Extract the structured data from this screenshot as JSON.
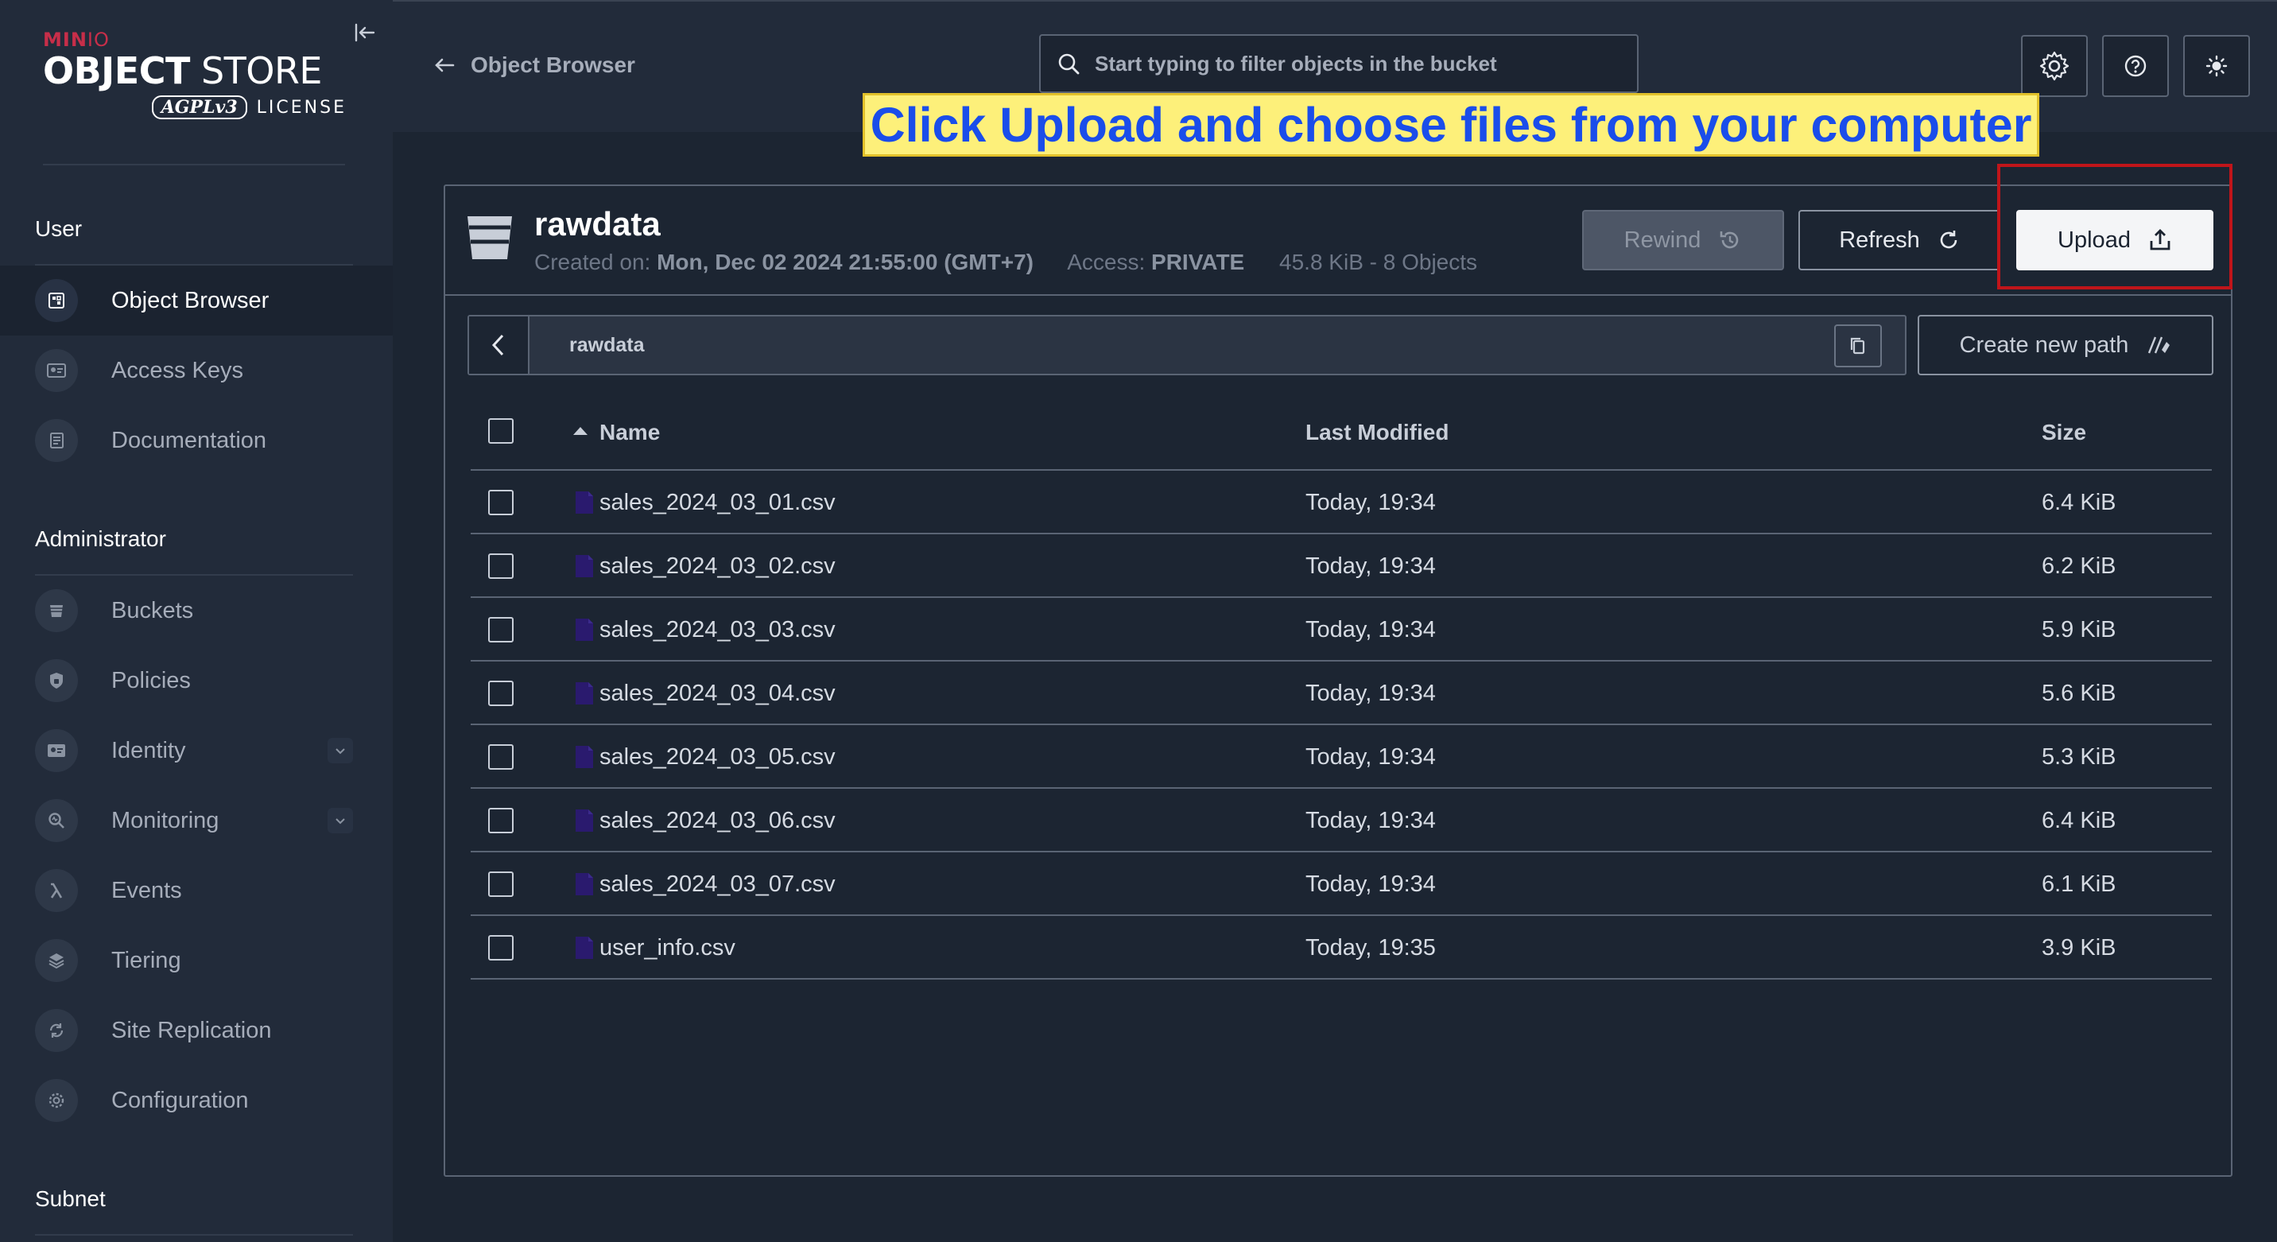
{
  "brand": {
    "min": "MIN",
    "io": "IO",
    "title_bold": "OBJECT",
    "title_light": "STORE",
    "agpl": "AGPLv3",
    "license": "LICENSE"
  },
  "sidebar": {
    "sections": [
      {
        "label": "User"
      },
      {
        "label": "Administrator"
      },
      {
        "label": "Subnet"
      }
    ],
    "user_items": [
      {
        "label": "Object Browser",
        "icon": "object-browser-icon",
        "active": true
      },
      {
        "label": "Access Keys",
        "icon": "access-keys-icon"
      },
      {
        "label": "Documentation",
        "icon": "documentation-icon"
      }
    ],
    "admin_items": [
      {
        "label": "Buckets",
        "icon": "buckets-icon"
      },
      {
        "label": "Policies",
        "icon": "policies-icon"
      },
      {
        "label": "Identity",
        "icon": "identity-icon",
        "expandable": true
      },
      {
        "label": "Monitoring",
        "icon": "monitoring-icon",
        "expandable": true
      },
      {
        "label": "Events",
        "icon": "lambda-icon"
      },
      {
        "label": "Tiering",
        "icon": "tiering-icon"
      },
      {
        "label": "Site Replication",
        "icon": "site-replication-icon"
      },
      {
        "label": "Configuration",
        "icon": "configuration-icon"
      }
    ]
  },
  "header": {
    "back_label": "Object Browser",
    "search_placeholder": "Start typing to filter objects in the bucket"
  },
  "annotation": {
    "text": "Click Upload and choose files from your computer"
  },
  "bucket": {
    "name": "rawdata",
    "created_label": "Created on:",
    "created_value": "Mon, Dec 02 2024 21:55:00 (GMT+7)",
    "access_label": "Access:",
    "access_value": "PRIVATE",
    "stats": "45.8 KiB - 8 Objects"
  },
  "actions": {
    "rewind": "Rewind",
    "refresh": "Refresh",
    "upload": "Upload",
    "create_path": "Create new path"
  },
  "path": {
    "current": "rawdata"
  },
  "table": {
    "columns": {
      "name": "Name",
      "modified": "Last Modified",
      "size": "Size"
    },
    "rows": [
      {
        "name": "sales_2024_03_01.csv",
        "modified": "Today, 19:34",
        "size": "6.4 KiB"
      },
      {
        "name": "sales_2024_03_02.csv",
        "modified": "Today, 19:34",
        "size": "6.2 KiB"
      },
      {
        "name": "sales_2024_03_03.csv",
        "modified": "Today, 19:34",
        "size": "5.9 KiB"
      },
      {
        "name": "sales_2024_03_04.csv",
        "modified": "Today, 19:34",
        "size": "5.6 KiB"
      },
      {
        "name": "sales_2024_03_05.csv",
        "modified": "Today, 19:34",
        "size": "5.3 KiB"
      },
      {
        "name": "sales_2024_03_06.csv",
        "modified": "Today, 19:34",
        "size": "6.4 KiB"
      },
      {
        "name": "sales_2024_03_07.csv",
        "modified": "Today, 19:34",
        "size": "6.1 KiB"
      },
      {
        "name": "user_info.csv",
        "modified": "Today, 19:35",
        "size": "3.9 KiB"
      }
    ]
  },
  "colors": {
    "accent_annotation": "#1a4dea",
    "highlight_box": "#c0151a",
    "file_icon": "#2a1a6e"
  }
}
